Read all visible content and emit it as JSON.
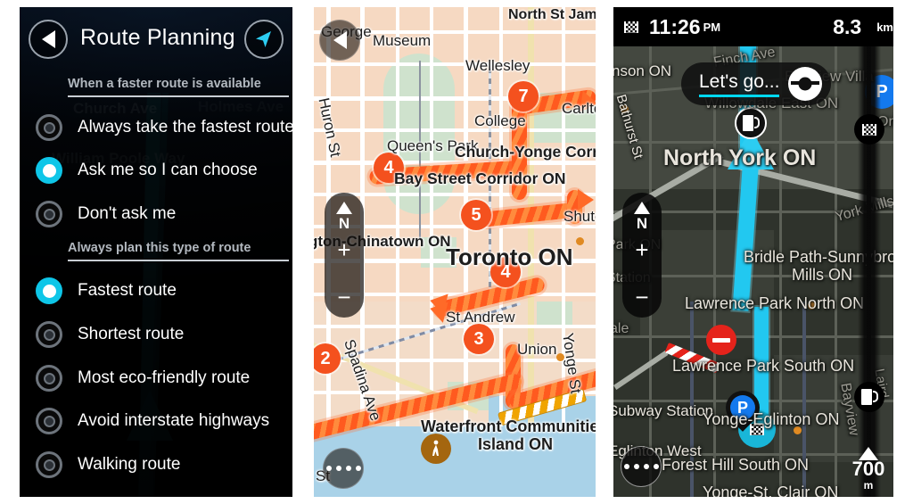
{
  "panels": {
    "settings": {
      "title": "Route Planning",
      "back_icon": "back-arrow-icon",
      "compass_icon": "navigation-arrow-icon",
      "sections": [
        {
          "heading": "When a faster route is available",
          "options": [
            {
              "label": "Always take the fastest route",
              "selected": false
            },
            {
              "label": "Ask me so I can choose",
              "selected": true
            },
            {
              "label": "Don't ask me",
              "selected": false
            }
          ]
        },
        {
          "heading": "Always plan this type of route",
          "options": [
            {
              "label": "Fastest route",
              "selected": true
            },
            {
              "label": "Shortest route",
              "selected": false
            },
            {
              "label": "Most eco-friendly route",
              "selected": false
            },
            {
              "label": "Avoid interstate highways",
              "selected": false
            },
            {
              "label": "Walking route",
              "selected": false
            }
          ]
        }
      ],
      "background_map_labels": [
        "Church Ave",
        "Holmes Ave",
        "William Poole Way"
      ],
      "accent_color": "#0ec6e8"
    },
    "traffic_map": {
      "place_labels": [
        "George",
        "Museum",
        "Wellesley",
        "North St James",
        "Carlton",
        "College",
        "Huron St",
        "Queen's Park",
        "Church-Yonge Corridor",
        "Bay Street Corridor ON",
        "gton-Chinatown ON",
        "Toronto ON",
        "Shute",
        "St Andrew",
        "Spadina Ave",
        "Yonge St",
        "Union",
        "Waterfront Communities-",
        "Island ON",
        "St"
      ],
      "traffic_incidents": [
        {
          "delay": "7"
        },
        {
          "delay": "4"
        },
        {
          "delay": "5"
        },
        {
          "delay": "4"
        },
        {
          "delay": "3"
        },
        {
          "delay": "2"
        }
      ],
      "compass_label": "N",
      "zoom_in_label": "+",
      "zoom_out_label": "−",
      "menu_icon": "more-options-icon",
      "back_icon": "back-arrow-icon",
      "pedestrian_icon": "pedestrian-zone-icon",
      "traffic_color": "#ff5a1f",
      "badge_color": "#f4511e"
    },
    "navigation": {
      "status": {
        "flag_icon": "checkered-flag-icon",
        "time": "11:26",
        "time_period": "PM",
        "distance": "8.3",
        "distance_unit": "km"
      },
      "prompt": {
        "label": "Let's go...",
        "icon": "steering-wheel-icon",
        "underline_color": "#00d8f0"
      },
      "place_labels": [
        "nson ON",
        "Finch Ave",
        "Bathurst St",
        "Willowdale East ON",
        "Bayview Villa",
        "North York ON",
        "Ori",
        "York Mills",
        "Park ON",
        "Station",
        "Bridle Path-Sunnybrook-Y",
        "Mills ON",
        "Lawrence Park North ON",
        "ale",
        "Lawrence Park South ON",
        "Subway Station",
        "Yonge-Eglinton ON",
        "Eglinton West",
        "Forest Hill South ON",
        "Yonge-St. Clair ON",
        "Bayview",
        "Laird"
      ],
      "compass_label": "N",
      "zoom_in_label": "+",
      "zoom_out_label": "−",
      "menu_icon": "more-options-icon",
      "scale": {
        "value": "700",
        "unit": "m",
        "icon": "north-arrow-icon"
      },
      "markers": [
        {
          "type": "parking-marker",
          "label": "P"
        },
        {
          "type": "fuel-stop-marker",
          "label": ""
        },
        {
          "type": "destination-flag-marker",
          "label": ""
        },
        {
          "type": "road-closed-marker",
          "label": ""
        },
        {
          "type": "vehicle-position-marker",
          "label": ""
        }
      ],
      "route_color": "#22c8f0",
      "parking_color": "#1379ee"
    }
  }
}
